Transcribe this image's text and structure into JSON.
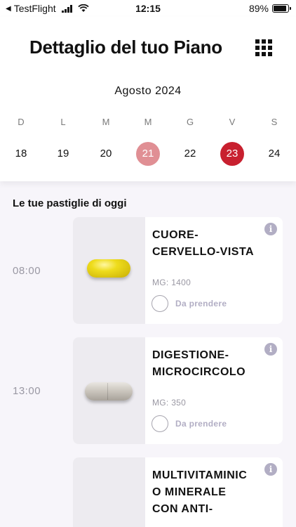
{
  "status_bar": {
    "carrier": "TestFlight",
    "time": "12:15",
    "battery": "89%",
    "battery_level": 0.89
  },
  "header": {
    "title": "Dettaglio del tuo Piano",
    "menu_icon": "grid-icon"
  },
  "calendar": {
    "month": "Agosto 2024",
    "weekdays": [
      "D",
      "L",
      "M",
      "M",
      "G",
      "V",
      "S"
    ],
    "days": [
      "18",
      "19",
      "20",
      "21",
      "22",
      "23",
      "24"
    ],
    "highlighted_day": "21",
    "selected_day": "23",
    "colors": {
      "highlight": "#e08f94",
      "selected": "#c8202f"
    }
  },
  "pills_section": {
    "title": "Le tue pastiglie di oggi",
    "items": [
      {
        "time": "08:00",
        "name_lines": [
          "CUORE-",
          "CERVELLO-VISTA"
        ],
        "mg": "MG: 1400",
        "status": "Da prendere",
        "image": "yellow-softgel-pill"
      },
      {
        "time": "13:00",
        "name_lines": [
          "DIGESTIONE-",
          "MICROCIRCOLO"
        ],
        "mg": "MG: 350",
        "status": "Da prendere",
        "image": "white-capsule-pill"
      },
      {
        "time": "",
        "name_lines": [
          "MULTIVITAMINIC",
          "O MINERALE",
          "CON ANTI-"
        ],
        "mg": "",
        "status": "",
        "image": ""
      }
    ]
  }
}
